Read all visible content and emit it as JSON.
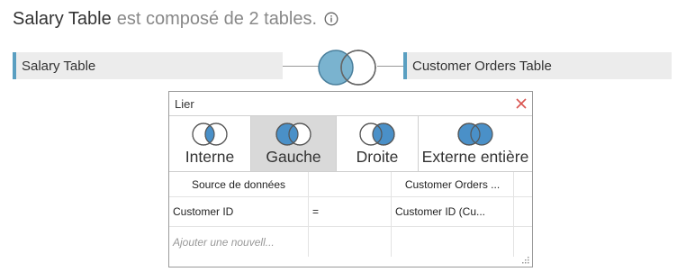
{
  "header": {
    "title": "Salary Table",
    "subtitle": "est composé de 2 tables.",
    "info_icon": "info-circle-icon"
  },
  "tables": {
    "left": "Salary Table",
    "right": "Customer Orders Table",
    "accent_color": "#5a9fc1"
  },
  "join_dialog": {
    "title": "Lier",
    "close_icon": "close-icon",
    "close_color": "#d9534f",
    "join_types": [
      {
        "label": "Interne",
        "selected": false
      },
      {
        "label": "Gauche",
        "selected": true
      },
      {
        "label": "Droite",
        "selected": false
      },
      {
        "label": "Externe entière",
        "selected": false
      }
    ],
    "columns": [
      "Source de données",
      "",
      "Customer Orders ..."
    ],
    "clauses": [
      {
        "left": "Customer ID",
        "operator": "=",
        "right": "Customer ID (Cu..."
      }
    ],
    "add_placeholder": "Ajouter une nouvell..."
  },
  "colors": {
    "venn_fill": "#4a90c8",
    "venn_join_fill": "#7ab3cf",
    "selected_bg": "#d9d9d9"
  }
}
